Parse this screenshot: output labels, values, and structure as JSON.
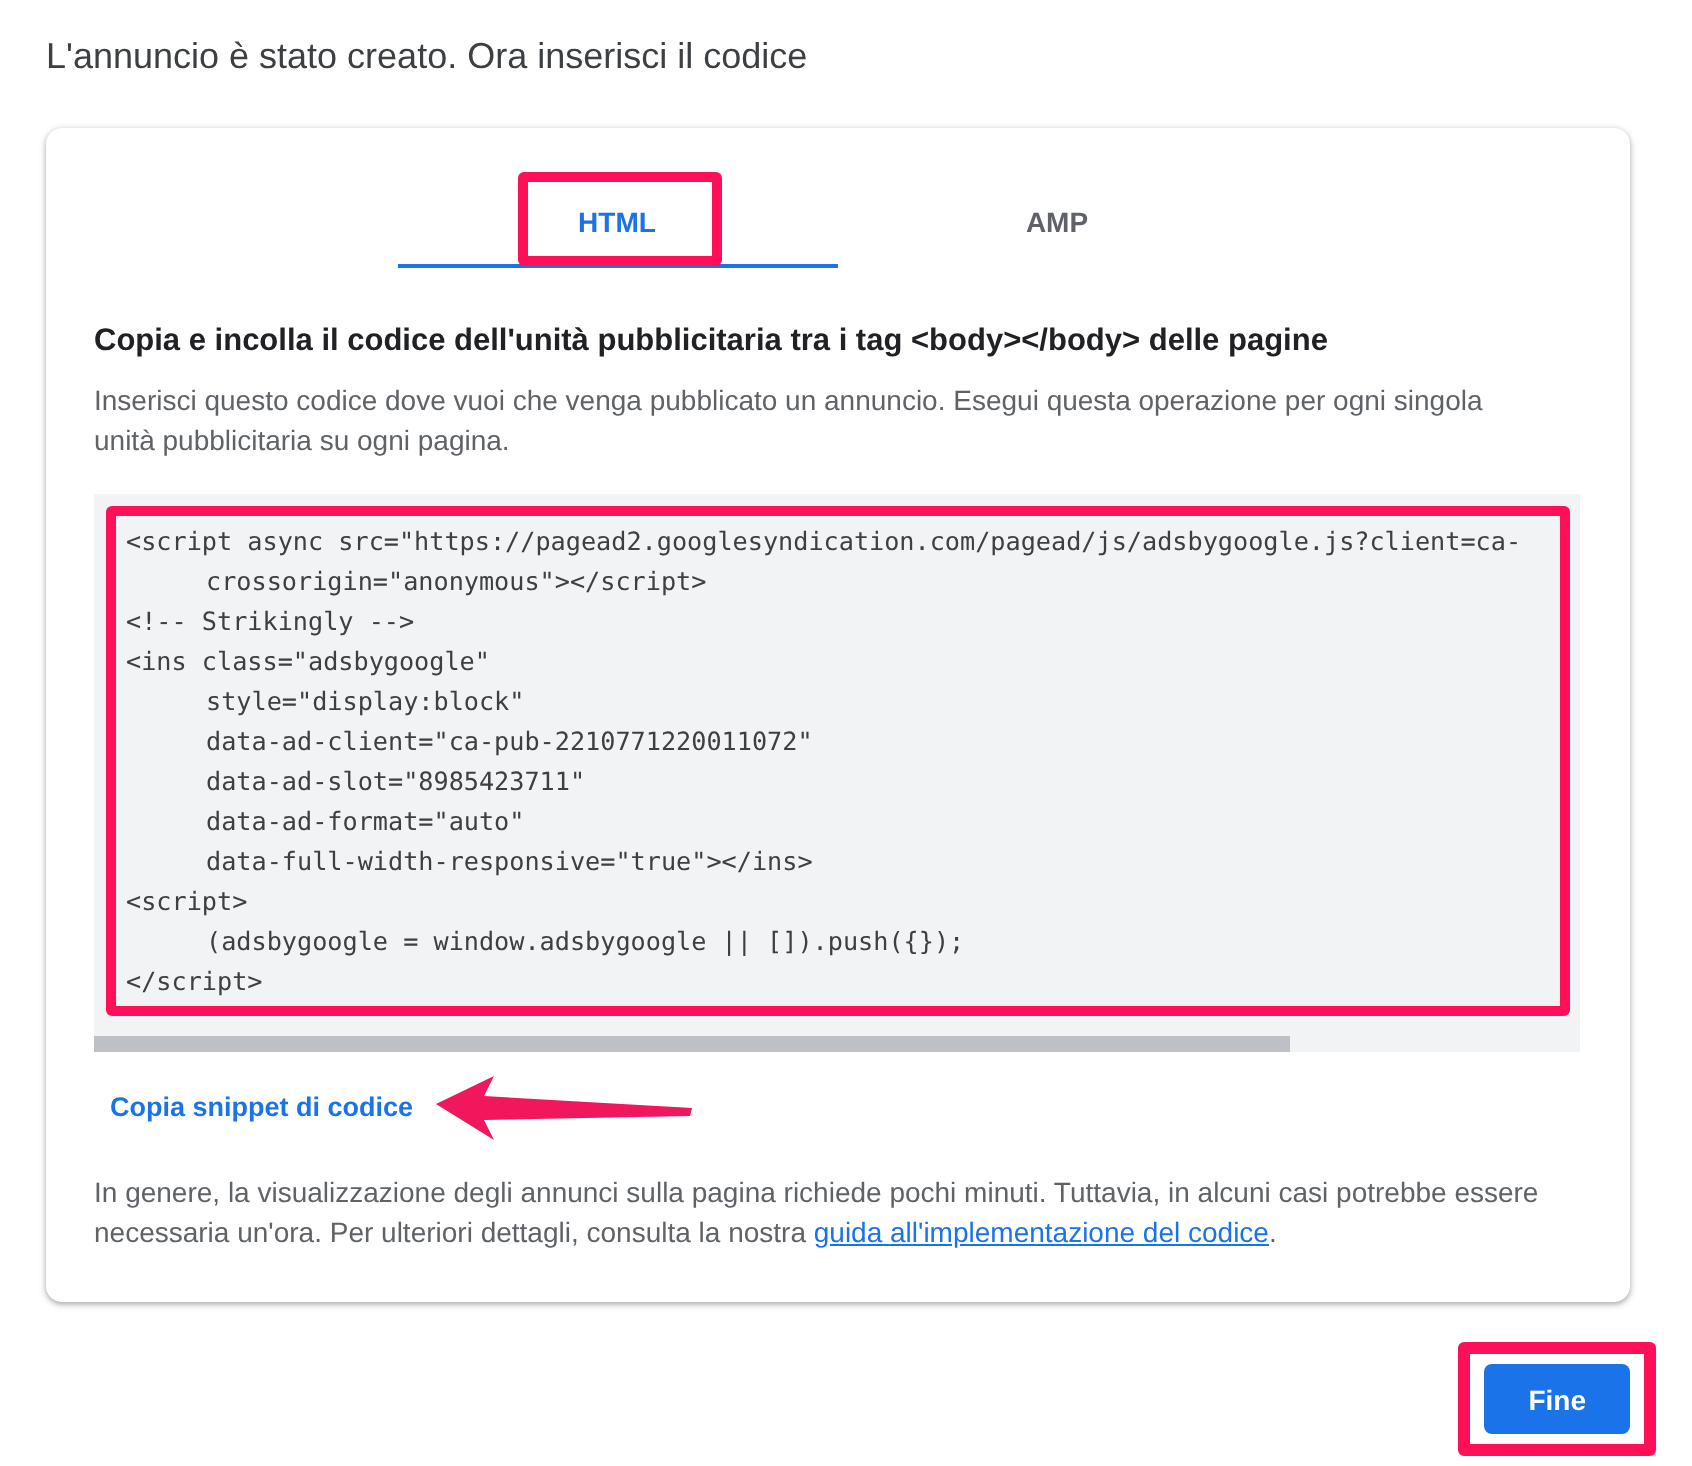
{
  "page": {
    "title": "L'annuncio è stato creato. Ora inserisci il codice"
  },
  "card": {
    "tabs": [
      {
        "label": "HTML",
        "selected": true,
        "highlighted": true
      },
      {
        "label": "AMP",
        "selected": false,
        "highlighted": false
      }
    ],
    "heading": "Copia e incolla il codice dell'unità pubblicitaria tra i tag <body></body> delle pagine",
    "description": "Inserisci questo codice dove vuoi che venga pubblicato un annuncio. Esegui questa operazione per ogni singola unità pubblicitaria su ogni pagina.",
    "code": {
      "highlighted": true,
      "lines": [
        {
          "text": "<script async src=\"https://pagead2.googlesyndication.com/pagead/js/adsbygoogle.js?client=ca-",
          "indented": false
        },
        {
          "text": "crossorigin=\"anonymous\"></script>",
          "indented": true
        },
        {
          "text": "<!-- Strikingly -->",
          "indented": false
        },
        {
          "text": "<ins class=\"adsbygoogle\"",
          "indented": false
        },
        {
          "text": "style=\"display:block\"",
          "indented": true
        },
        {
          "text": "data-ad-client=\"ca-pub-2210771220011072\"",
          "indented": true
        },
        {
          "text": "data-ad-slot=\"8985423711\"",
          "indented": true
        },
        {
          "text": "data-ad-format=\"auto\"",
          "indented": true
        },
        {
          "text": "data-full-width-responsive=\"true\"></ins>",
          "indented": true
        },
        {
          "text": "<script>",
          "indented": false
        },
        {
          "text": "(adsbygoogle = window.adsbygoogle || []).push({});",
          "indented": true
        },
        {
          "text": "</script>",
          "indented": false
        }
      ]
    },
    "copy_link": {
      "label": "Copia snippet di codice",
      "arrow": true
    },
    "note": {
      "text": "In genere, la visualizzazione degli annunci sulla pagina richiede pochi minuti. Tuttavia, in alcuni casi potrebbe essere necessaria un'ora. Per ulteriori dettagli, consulta la nostra ",
      "link": "guida all'implementazione del codice",
      "after": "."
    }
  },
  "buttons": [
    {
      "label": "Fine",
      "kind": "primary",
      "highlighted": true
    }
  ]
}
